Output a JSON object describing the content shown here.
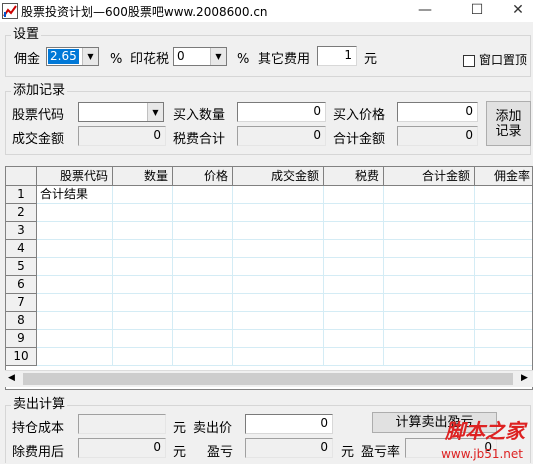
{
  "window": {
    "title": "股票投资计划—600股票吧www.2008600.cn",
    "minimize_glyph": "—",
    "maximize_glyph": "☐",
    "close_glyph": "✕"
  },
  "settings": {
    "group_title": "设置",
    "commission_label": "佣金",
    "commission_value": "2.65",
    "commission_unit": "%",
    "stamp_tax_label": "印花税",
    "stamp_tax_value": "0",
    "stamp_tax_unit": "%",
    "other_fees_label": "其它费用",
    "other_fees_value": "1",
    "other_fees_unit": "元",
    "topmost_label": "窗口置顶"
  },
  "add_record": {
    "group_title": "添加记录",
    "stock_code_label": "股票代码",
    "stock_code_value": "",
    "buy_qty_label": "买入数量",
    "buy_qty_value": "0",
    "buy_price_label": "买入价格",
    "buy_price_value": "0",
    "deal_amount_label": "成交金额",
    "deal_amount_value": "0",
    "tax_total_label": "税费合计",
    "tax_total_value": "0",
    "total_amount_label": "合计金额",
    "total_amount_value": "0",
    "add_button_line1": "添加",
    "add_button_line2": "记录"
  },
  "grid": {
    "columns": [
      "股票代码",
      "数量",
      "价格",
      "成交金额",
      "税费",
      "合计金额",
      "佣金率"
    ],
    "row_numbers": [
      "1",
      "2",
      "3",
      "4",
      "5",
      "6",
      "7",
      "8",
      "9",
      "10"
    ],
    "row1_text": "合计结果"
  },
  "sell": {
    "group_title": "卖出计算",
    "cost_label": "持仓成本",
    "cost_value": "",
    "cost_unit": "元",
    "sell_price_label": "卖出价",
    "sell_price_value": "0",
    "after_fee_label": "除费用后",
    "after_fee_value": "0",
    "after_fee_unit": "元",
    "pnl_label": "盈亏",
    "pnl_value": "0",
    "pnl_unit": "元",
    "pnl_rate_label": "盈亏率",
    "pnl_rate_value": "0",
    "calc_button": "计算卖出盈亏"
  },
  "watermark": {
    "logo_text": "脚本之家",
    "url_text": "www.jb51.net"
  },
  "colors": {
    "accent": "#0078d7",
    "grid_line": "#d4ecf5",
    "watermark": "#dd2222"
  }
}
